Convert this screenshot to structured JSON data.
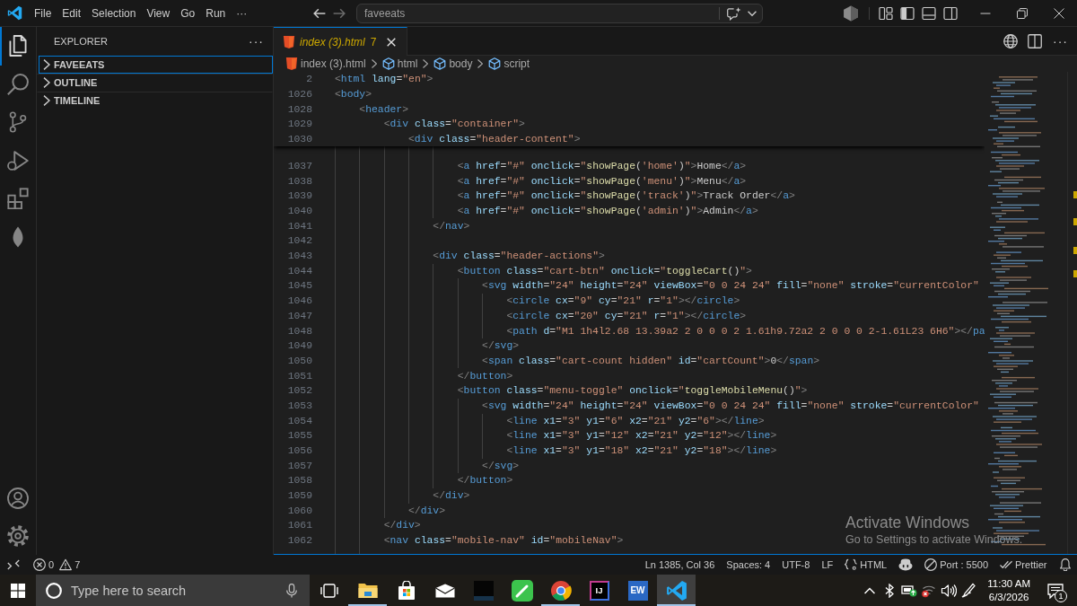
{
  "title_bar": {
    "menu": [
      "File",
      "Edit",
      "Selection",
      "View",
      "Go",
      "Run",
      "···"
    ],
    "nav": [
      {
        "kind": "back",
        "disabled": false
      },
      {
        "kind": "forward",
        "disabled": true
      }
    ],
    "command_center": {
      "value": "faveeats"
    },
    "layout_toggles": [
      {
        "kind": "customize",
        "on": false
      },
      {
        "kind": "primary_sidebar",
        "on": true
      },
      {
        "kind": "panel",
        "on": false
      },
      {
        "kind": "secondary_sidebar",
        "on": false
      }
    ]
  },
  "activity_bar": {
    "items": [
      {
        "kind": "explorer",
        "selected": true
      },
      {
        "kind": "search",
        "selected": false
      },
      {
        "kind": "source_control",
        "selected": false
      },
      {
        "kind": "run_debug",
        "selected": false
      },
      {
        "kind": "extensions",
        "selected": false
      },
      {
        "kind": "leaf",
        "selected": false
      }
    ],
    "bottom": [
      {
        "kind": "account"
      },
      {
        "kind": "settings"
      }
    ]
  },
  "sidebar": {
    "title": "EXPLORER",
    "more": "···",
    "sections": [
      {
        "label": "FAVEEATS",
        "expanded": false,
        "focused": true
      },
      {
        "label": "OUTLINE",
        "expanded": false,
        "focused": false
      },
      {
        "label": "TIMELINE",
        "expanded": false,
        "focused": false
      }
    ]
  },
  "editor": {
    "tabs": [
      {
        "label": "index (3).html",
        "problems": "7",
        "preview": true,
        "warnings": true,
        "selected": true
      }
    ],
    "more": "···",
    "breadcrumbs": [
      {
        "kind": "file",
        "label": "index (3).html"
      },
      {
        "kind": "symbol",
        "label": "html"
      },
      {
        "kind": "symbol",
        "label": "body"
      },
      {
        "kind": "symbol",
        "label": "script"
      }
    ],
    "sticky_lines": [
      {
        "number": "2",
        "code": "<html lang=\"en\">"
      },
      {
        "number": "1026",
        "code": "<body>"
      },
      {
        "number": "1028",
        "code": "    <header>"
      },
      {
        "number": "1029",
        "code": "        <div class=\"container\">"
      },
      {
        "number": "1030",
        "code": "            <div class=\"header-content\">"
      }
    ],
    "lines": [
      {
        "number": "1037",
        "code": "                    <a href=\"#\" onclick=\"showPage('home')\">Home</a>"
      },
      {
        "number": "1038",
        "code": "                    <a href=\"#\" onclick=\"showPage('menu')\">Menu</a>"
      },
      {
        "number": "1039",
        "code": "                    <a href=\"#\" onclick=\"showPage('track')\">Track Order</a>"
      },
      {
        "number": "1040",
        "code": "                    <a href=\"#\" onclick=\"showPage('admin')\">Admin</a>"
      },
      {
        "number": "1041",
        "code": "                </nav>"
      },
      {
        "number": "1042"
      },
      {
        "number": "1043",
        "code": "                <div class=\"header-actions\">"
      },
      {
        "number": "1044",
        "code": "                    <button class=\"cart-btn\" onclick=\"toggleCart()\">"
      },
      {
        "number": "1045",
        "code": "                        <svg width=\"24\" height=\"24\" viewBox=\"0 0 24 24\" fill=\"none\" stroke=\"currentColor\""
      },
      {
        "number": "1046",
        "code": "                            <circle cx=\"9\" cy=\"21\" r=\"1\"></circle>"
      },
      {
        "number": "1047",
        "code": "                            <circle cx=\"20\" cy=\"21\" r=\"1\"></circle>"
      },
      {
        "number": "1048",
        "code": "                            <path d=\"M1 1h4l2.68 13.39a2 2 0 0 0 2 1.61h9.72a2 2 0 0 0 2-1.61L23 6H6\"></pa"
      },
      {
        "number": "1049",
        "code": "                        </svg>"
      },
      {
        "number": "1050",
        "code": "                        <span class=\"cart-count hidden\" id=\"cartCount\">0</span>"
      },
      {
        "number": "1051",
        "code": "                    </button>"
      },
      {
        "number": "1052",
        "code": "                    <button class=\"menu-toggle\" onclick=\"toggleMobileMenu()\">"
      },
      {
        "number": "1053",
        "code": "                        <svg width=\"24\" height=\"24\" viewBox=\"0 0 24 24\" fill=\"none\" stroke=\"currentColor\""
      },
      {
        "number": "1054",
        "code": "                            <line x1=\"3\" y1=\"6\" x2=\"21\" y2=\"6\"></line>"
      },
      {
        "number": "1055",
        "code": "                            <line x1=\"3\" y1=\"12\" x2=\"21\" y2=\"12\"></line>"
      },
      {
        "number": "1056",
        "code": "                            <line x1=\"3\" y1=\"18\" x2=\"21\" y2=\"18\"></line>"
      },
      {
        "number": "1057",
        "code": "                        </svg>"
      },
      {
        "number": "1058",
        "code": "                    </button>"
      },
      {
        "number": "1059",
        "code": "                </div>"
      },
      {
        "number": "1060",
        "code": "            </div>"
      },
      {
        "number": "1061",
        "code": "        </div>"
      },
      {
        "number": "1062",
        "code": "        <nav class=\"mobile-nav\" id=\"mobileNav\">"
      }
    ]
  },
  "activation_notice": {
    "title": "Activate Windows",
    "text": "Go to Settings to activate Windows."
  },
  "status_bar": {
    "errors": "0",
    "warnings": "7",
    "items": [
      {
        "kind": "text",
        "label": "Ln 1385, Col 36"
      },
      {
        "kind": "text",
        "label": "Spaces: 4"
      },
      {
        "kind": "text",
        "label": "UTF-8"
      },
      {
        "kind": "text",
        "label": "LF"
      },
      {
        "kind": "language",
        "label": "HTML"
      },
      {
        "kind": "copilot"
      },
      {
        "kind": "port",
        "label": "Port : 5500"
      },
      {
        "kind": "prettier",
        "label": "Prettier"
      },
      {
        "kind": "bell"
      }
    ]
  },
  "taskbar": {
    "search": {
      "placeholder": "Type here to search"
    },
    "apps": [
      {
        "kind": "task_view",
        "running": false,
        "selected": false
      },
      {
        "kind": "folder",
        "running": true,
        "selected": false
      },
      {
        "kind": "store",
        "running": false,
        "selected": false
      },
      {
        "kind": "mail",
        "running": false,
        "selected": false
      },
      {
        "kind": "dark_tile",
        "running": false,
        "selected": false
      },
      {
        "kind": "pen_tile",
        "running": false,
        "selected": false
      },
      {
        "kind": "ball",
        "running": true,
        "selected": false
      },
      {
        "kind": "ide_tile",
        "label": "IJ",
        "running": false,
        "selected": false
      },
      {
        "kind": "blue_tile",
        "label": "EW",
        "running": false,
        "selected": false
      },
      {
        "kind": "code",
        "running": true,
        "selected": true
      }
    ],
    "tray": [
      {
        "kind": "chevron"
      },
      {
        "kind": "bluetooth"
      },
      {
        "kind": "power"
      },
      {
        "kind": "wifi_off"
      },
      {
        "kind": "volume"
      },
      {
        "kind": "pen"
      }
    ],
    "clock": {
      "time": "11:30 AM",
      "date": "6/3/2026"
    },
    "notifications": {
      "count": "1"
    }
  }
}
